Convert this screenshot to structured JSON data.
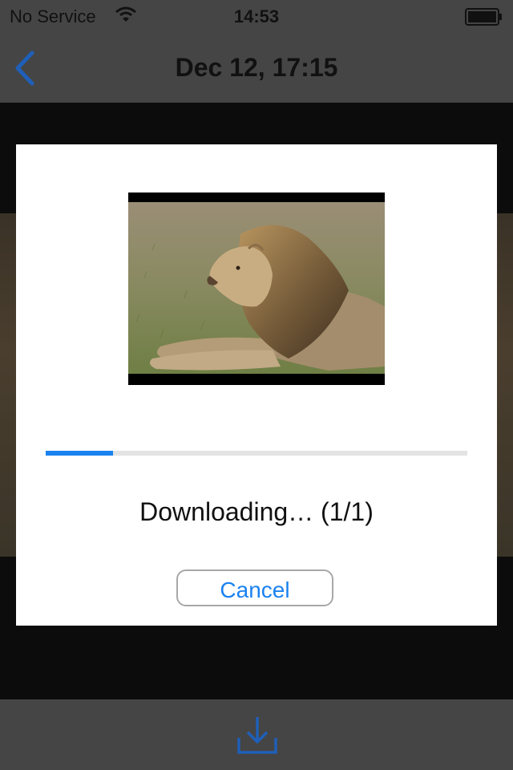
{
  "status_bar": {
    "carrier": "No Service",
    "time": "14:53"
  },
  "nav_bar": {
    "title": "Dec 12, 17:15"
  },
  "modal": {
    "status_text": "Downloading… (1/1)",
    "cancel_label": "Cancel",
    "progress_fraction": 0.16
  },
  "colors": {
    "accent": "#1a82f0",
    "nav_icon": "#1f5fb8",
    "bars": "#454545"
  },
  "icons": {
    "back": "chevron-left-icon",
    "download": "download-tray-icon",
    "wifi": "wifi-icon",
    "battery": "battery-icon"
  }
}
